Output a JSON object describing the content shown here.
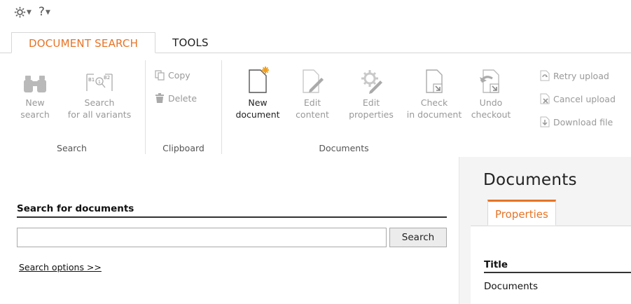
{
  "topbar": {
    "settings_icon": "gear-icon",
    "help_label": "?"
  },
  "tabs": [
    {
      "label": "DOCUMENT SEARCH",
      "active": true
    },
    {
      "label": "TOOLS",
      "active": false
    }
  ],
  "ribbon": {
    "search_group": {
      "name": "Search",
      "new_search": {
        "line1": "New",
        "line2": "search",
        "icon": "binoculars-icon"
      },
      "search_all": {
        "line1": "Search",
        "line2": "for all variants",
        "icon": "variants-search-icon"
      }
    },
    "clipboard_group": {
      "name": "Clipboard",
      "copy": "Copy",
      "delete": "Delete"
    },
    "documents_group": {
      "name": "Documents",
      "new_document": {
        "line1": "New",
        "line2": "document",
        "icon": "new-document-icon"
      },
      "edit_content": {
        "line1": "Edit",
        "line2": "content",
        "icon": "edit-content-icon"
      },
      "edit_properties": {
        "line1": "Edit",
        "line2": "properties",
        "icon": "edit-properties-icon"
      },
      "check_in": {
        "line1": "Check",
        "line2": "in document",
        "icon": "check-in-icon"
      },
      "undo_checkout": {
        "line1": "Undo",
        "line2": "checkout",
        "icon": "undo-checkout-icon"
      },
      "retry_upload": "Retry upload",
      "cancel_upload": "Cancel upload",
      "download_file": "Download file"
    }
  },
  "search_panel": {
    "title": "Search for documents",
    "input_value": "",
    "search_button": "Search",
    "options_link": "Search options >>"
  },
  "documents_panel": {
    "title": "Documents",
    "properties_tab": "Properties",
    "title_label": "Title",
    "title_value": "Documents"
  },
  "colors": {
    "accent": "#e67426",
    "disabled": "#999999"
  }
}
